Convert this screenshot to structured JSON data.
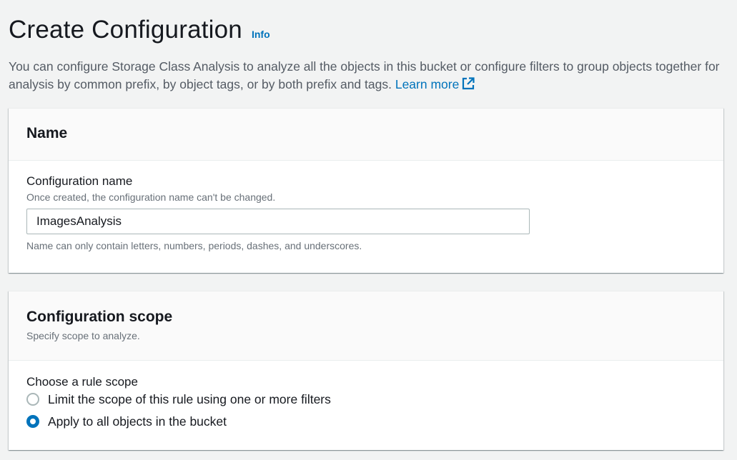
{
  "header": {
    "title": "Create Configuration",
    "info_label": "Info"
  },
  "description": {
    "text": "You can configure Storage Class Analysis to analyze all the objects in this bucket or configure filters to group objects together for analysis by common prefix, by object tags, or by both prefix and tags.",
    "learn_more_label": "Learn more",
    "learn_more_icon": "external-link-icon"
  },
  "name_panel": {
    "title": "Name",
    "field_label": "Configuration name",
    "field_description": "Once created, the configuration name can't be changed.",
    "field_value": "ImagesAnalysis",
    "field_constraint": "Name can only contain letters, numbers, periods, dashes, and underscores."
  },
  "scope_panel": {
    "title": "Configuration scope",
    "subtitle": "Specify scope to analyze.",
    "choice_label": "Choose a rule scope",
    "options": [
      {
        "label": "Limit the scope of this rule using one or more filters",
        "selected": false
      },
      {
        "label": "Apply to all objects in the bucket",
        "selected": true
      }
    ]
  },
  "colors": {
    "link": "#0073bb",
    "page_background": "#f2f3f3",
    "panel_header_background": "#fafafa"
  }
}
